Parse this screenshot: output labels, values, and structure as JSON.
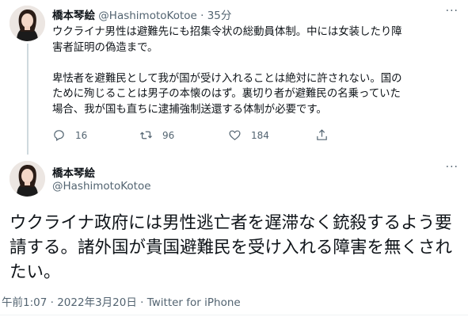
{
  "tweet1": {
    "author_name": "橋本琴絵",
    "author_handle": "@HashimotoKotoe",
    "separator": "·",
    "time_ago": "35分",
    "text": "ウクライナ男性は避難先にも招集令状の総動員体制。中には女装したり障\n害者証明の偽造まで。\n\n卑怯者を避難民として我が国が受け入れることは絶対に許されない。国の\nために殉じることは男子の本懐のはず。裏切り者が避難民の名乗っていた\n場合、我が国も直ちに逮捕強制送還する体制が必要です。",
    "replies": "16",
    "retweets": "96",
    "likes": "184",
    "more": "···"
  },
  "tweet2": {
    "author_name": "橋本琴絵",
    "author_handle": "@HashimotoKotoe",
    "text": "ウクライナ政府には男性逃亡者を遅滞なく銃殺するよう要請する。諸外国が貴国避難民を受け入れる障害を無くされたい。",
    "time": "午前1:07",
    "separator": "·",
    "date": "2022年3月20日",
    "separator2": "·",
    "source": "Twitter for iPhone",
    "more": "···"
  },
  "icons": {
    "reply": "reply-icon",
    "retweet": "retweet-icon",
    "like": "heart-icon",
    "share": "share-icon",
    "more": "more-icon"
  }
}
